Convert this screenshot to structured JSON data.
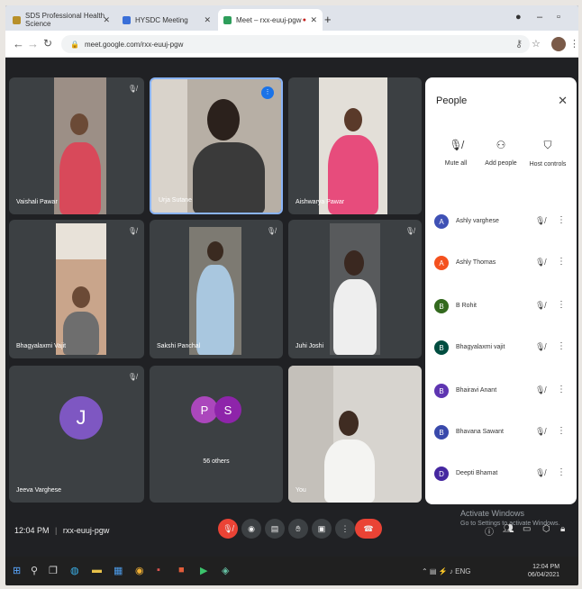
{
  "tabs": [
    {
      "title": "SDS Professional Health Science",
      "favicon_color": "#b8902a"
    },
    {
      "title": "HYSDC Meeting",
      "favicon_color": "#3a6fd8"
    },
    {
      "title": "Meet – rxx-euuj-pgw",
      "favicon_color": "#2e9e5b"
    }
  ],
  "browser": {
    "url": "meet.google.com/rxx-euuj-pgw"
  },
  "tiles": [
    {
      "name": "Vaishali Pawar",
      "kind": "video"
    },
    {
      "name": "Urja Sutane",
      "kind": "video"
    },
    {
      "name": "Aishwarya Pawar",
      "kind": "video"
    },
    {
      "name": "Bhagyalaxmi Vajit",
      "kind": "video"
    },
    {
      "name": "Sakshi Panchal",
      "kind": "video"
    },
    {
      "name": "Juhi Joshi",
      "kind": "video"
    },
    {
      "name": "Jeeva Varghese",
      "kind": "avatar",
      "initial": "J",
      "color": "#7e57c2"
    },
    {
      "name": "56 others",
      "kind": "group",
      "initials": [
        "P",
        "S"
      ],
      "colors": [
        "#ab47bc",
        "#8e24aa"
      ]
    },
    {
      "name": "You",
      "kind": "video"
    }
  ],
  "people_panel": {
    "title": "People",
    "actions": [
      {
        "label": "Mute all",
        "icon": "mic-off-icon"
      },
      {
        "label": "Add people",
        "icon": "add-person-icon"
      },
      {
        "label": "Host controls",
        "icon": "shield-icon"
      }
    ],
    "participants": [
      {
        "name": "Ashly varghese",
        "initial": "A",
        "color": "#3f51b5"
      },
      {
        "name": "Ashly Thomas",
        "initial": "A",
        "color": "#f4511e"
      },
      {
        "name": "B Rohit",
        "initial": "B",
        "color": "#33691e"
      },
      {
        "name": "Bhagyalaxmi vajit",
        "initial": "B",
        "color": "#004d40"
      },
      {
        "name": "Bhairavi Anant",
        "initial": "B",
        "color": "#5e35b1"
      },
      {
        "name": "Bhavana Sawant",
        "initial": "B",
        "color": "#3949ab"
      },
      {
        "name": "Deepti Bhamat",
        "initial": "D",
        "color": "#4527a0"
      }
    ]
  },
  "meeting": {
    "time": "12:04 PM",
    "separator": "|",
    "code": "rxx-euuj-pgw"
  },
  "watermark": {
    "line1": "Activate Windows",
    "line2": "Go to Settings to activate Windows."
  },
  "taskbar": {
    "time": "12:04 PM",
    "date": "06/04/2021"
  }
}
